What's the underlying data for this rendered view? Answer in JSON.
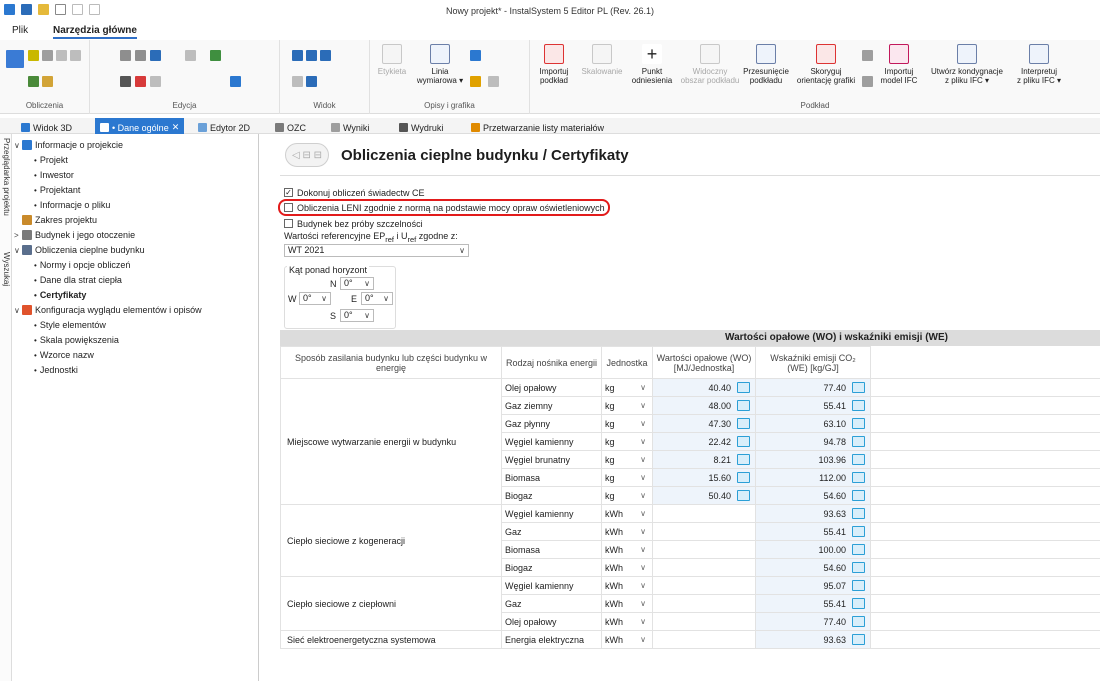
{
  "app": {
    "title": "Nowy projekt* - InstalSystem 5 Editor PL (Rev. 26.1)"
  },
  "menu": {
    "file": "Plik",
    "home": "Narzędzia główne"
  },
  "ribbon": {
    "groups": {
      "calc": "Obliczenia",
      "edit": "Edycja",
      "view": "Widok",
      "descriptions": "Opisy i grafika",
      "background": "Podkład"
    },
    "buttons": {
      "label": "Etykieta",
      "dimension_l1": "Linia",
      "dimension_l2": "wymiarowa ▾",
      "import_l1": "Importuj",
      "import_l2": "podkład",
      "scale_l1": "Skalowanie",
      "scale_l2": "",
      "ref_l1": "Punkt",
      "ref_l2": "odniesienia",
      "visible_l1": "Widoczny",
      "visible_l2": "obszar podkładu",
      "move_l1": "Przesunięcie",
      "move_l2": "podkładu",
      "fix_l1": "Skoryguj",
      "fix_l2": "orientację grafiki",
      "ifc_l1": "Importuj",
      "ifc_l2": "model IFC",
      "cond_l1": "Utwórz kondygnacje",
      "cond_l2": "z pliku IFC ▾",
      "interp_l1": "Interpretuj",
      "interp_l2": "z pliku IFC ▾"
    }
  },
  "tabs": [
    "Widok 3D",
    "• Dane ogólne",
    "Edytor 2D",
    "OZC",
    "Wyniki",
    "Wydruki",
    "Przetwarzanie listy materiałów"
  ],
  "side_strip": {
    "browser": "Przeglądarka projektu",
    "search": "Wyszukaj"
  },
  "tree": [
    {
      "label": "Informacje o projekcie",
      "level": 0,
      "exp": "∨",
      "icon": "doc"
    },
    {
      "label": "Projekt",
      "level": 1
    },
    {
      "label": "Inwestor",
      "level": 1
    },
    {
      "label": "Projektant",
      "level": 1
    },
    {
      "label": "Informacje o pliku",
      "level": 1
    },
    {
      "label": "Zakres projektu",
      "level": 0,
      "exp": "",
      "icon": "scope"
    },
    {
      "label": "Budynek i jego otoczenie",
      "level": 0,
      "exp": ">",
      "icon": "house"
    },
    {
      "label": "Obliczenia cieplne budynku",
      "level": 0,
      "exp": "∨",
      "icon": "calc"
    },
    {
      "label": "Normy i opcje obliczeń",
      "level": 1
    },
    {
      "label": "Dane dla strat ciepła",
      "level": 1
    },
    {
      "label": "Certyfikaty",
      "level": 1,
      "selected": true
    },
    {
      "label": "Konfiguracja wyglądu elementów i opisów",
      "level": 0,
      "exp": "∨",
      "icon": "palette"
    },
    {
      "label": "Style elementów",
      "level": 1
    },
    {
      "label": "Skala powiększenia",
      "level": 1
    },
    {
      "label": "Wzorce nazw",
      "level": 1
    },
    {
      "label": "Jednostki",
      "level": 1
    }
  ],
  "page": {
    "title": "Obliczenia cieplne budynku / Certyfikaty",
    "back_label": "◁ ⊟ ⊟",
    "checkboxes": [
      {
        "label": "Dokonuj obliczeń świadectw CE",
        "checked": "✓"
      },
      {
        "label": "Obliczenia LENI zgodnie z normą na podstawie mocy opraw oświetleniowych",
        "checked": ""
      },
      {
        "label": "Budynek bez próby szczelności",
        "checked": ""
      }
    ],
    "ref_label_1": "Wartości referencyjne EP",
    "ref_sub_1": "ref",
    "ref_label_2": " i U",
    "ref_sub_2": "ref",
    "ref_label_3": " zgodne z:",
    "ref_select": "WT 2021",
    "angle_group": "Kąt ponad horyzont",
    "angles": {
      "N": "N",
      "E": "E",
      "S": "S",
      "W": "W",
      "val": "0°"
    },
    "table_title": "Wartości opałowe (WO) i wskaźniki emisji (WE)",
    "cols": [
      "Sposób zasilania budynku lub części budynku w energię",
      "Rodzaj nośnika energii",
      "Jednostka",
      "Wartości opałowe (WO) [MJ/Jednostka]",
      "Wskaźniki emisji CO₂ (WE) [kg/GJ]"
    ],
    "sections": [
      {
        "name": "Miejscowe wytwarzanie energii w budynku",
        "rows": [
          {
            "carrier": "Olej opałowy",
            "unit": "kg",
            "wo": "40.40",
            "we": "77.40"
          },
          {
            "carrier": "Gaz ziemny",
            "unit": "kg",
            "wo": "48.00",
            "we": "55.41"
          },
          {
            "carrier": "Gaz płynny",
            "unit": "kg",
            "wo": "47.30",
            "we": "63.10"
          },
          {
            "carrier": "Węgiel kamienny",
            "unit": "kg",
            "wo": "22.42",
            "we": "94.78"
          },
          {
            "carrier": "Węgiel brunatny",
            "unit": "kg",
            "wo": "8.21",
            "we": "103.96"
          },
          {
            "carrier": "Biomasa",
            "unit": "kg",
            "wo": "15.60",
            "we": "112.00"
          },
          {
            "carrier": "Biogaz",
            "unit": "kg",
            "wo": "50.40",
            "we": "54.60"
          }
        ]
      },
      {
        "name": "Ciepło sieciowe z kogeneracji",
        "rows": [
          {
            "carrier": "Węgiel kamienny",
            "unit": "kWh",
            "wo": "",
            "we": "93.63"
          },
          {
            "carrier": "Gaz",
            "unit": "kWh",
            "wo": "",
            "we": "55.41"
          },
          {
            "carrier": "Biomasa",
            "unit": "kWh",
            "wo": "",
            "we": "100.00"
          },
          {
            "carrier": "Biogaz",
            "unit": "kWh",
            "wo": "",
            "we": "54.60"
          }
        ]
      },
      {
        "name": "Ciepło sieciowe z ciepłowni",
        "rows": [
          {
            "carrier": "Węgiel kamienny",
            "unit": "kWh",
            "wo": "",
            "we": "95.07"
          },
          {
            "carrier": "Gaz",
            "unit": "kWh",
            "wo": "",
            "we": "55.41"
          },
          {
            "carrier": "Olej opałowy",
            "unit": "kWh",
            "wo": "",
            "we": "77.40"
          }
        ]
      },
      {
        "name": "Sieć elektroenergetyczna systemowa",
        "rows": [
          {
            "carrier": "Energia elektryczna",
            "unit": "kWh",
            "wo": "",
            "we": "93.63"
          }
        ]
      }
    ]
  },
  "colors": {
    "accent": "#2b78d0",
    "highlight": "#e21b1b",
    "cell_blue": "#eef4fb"
  }
}
